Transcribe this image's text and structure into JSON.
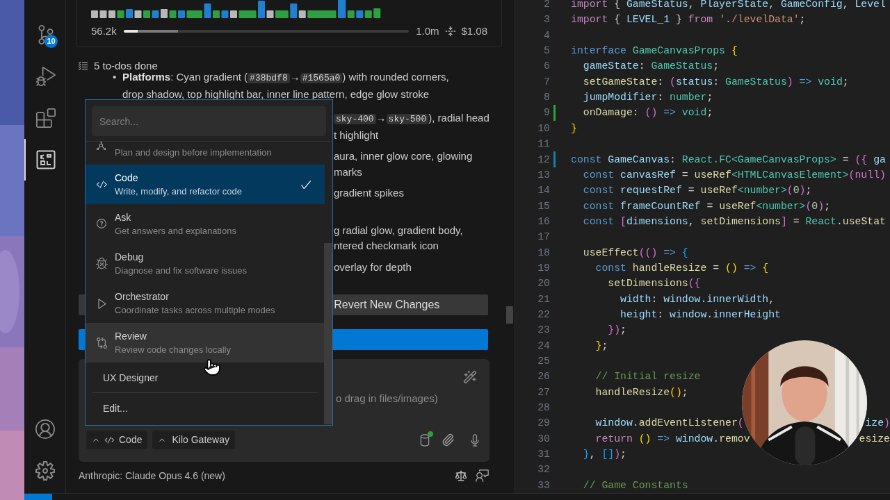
{
  "activity_bar": {
    "items": [
      {
        "selected": false,
        "badge": "10"
      },
      {
        "selected": false
      },
      {
        "selected": false
      },
      {
        "selected": true
      }
    ]
  },
  "usage": {
    "tokens": "56.2k",
    "context_window": "1.0m",
    "cost": "$1.08",
    "context_bar": {
      "used": {
        "level": 0.05
      },
      "reserved": {
        "level": 0.14
      }
    }
  },
  "todos": {
    "summary": "5 to-dos done"
  },
  "notes": [
    {
      "clipped": false,
      "marker": "•",
      "lines": [
        [
          {
            "kind": "bold",
            "text": "Platforms"
          },
          {
            "kind": "text",
            "text": ": Cyan gradient ("
          },
          {
            "kind": "code",
            "text": "#38bdf8"
          },
          {
            "kind": "text",
            "text": "→"
          },
          {
            "kind": "code",
            "text": "#1565a0"
          },
          {
            "kind": "text",
            "text": ") with rounded corners,"
          }
        ],
        [
          {
            "kind": "text",
            "text": "drop shadow, top highlight bar, inner line pattern, edge glow stroke"
          }
        ]
      ]
    },
    {
      "clipped": true,
      "lines": [
        [
          {
            "kind": "code",
            "text": "sky-400"
          },
          {
            "kind": "text",
            "text": "→"
          },
          {
            "kind": "code",
            "text": "sky-500"
          },
          {
            "kind": "text",
            "text": "), radial head"
          }
        ],
        [
          {
            "kind": "text",
            "text": "t highlight"
          }
        ]
      ]
    },
    {
      "clipped": true,
      "lines": [
        [
          {
            "kind": "text",
            "text": "aura, inner glow core, glowing"
          }
        ],
        [
          {
            "kind": "text",
            "text": "marks"
          }
        ]
      ]
    },
    {
      "clipped": true,
      "lines": [
        [
          {
            "kind": "text",
            "text": "gradient spikes"
          }
        ]
      ]
    },
    {
      "clipped": true,
      "lines": [
        [
          {
            "kind": "text",
            "text": "g radial glow, gradient body,"
          }
        ],
        [
          {
            "kind": "text",
            "text": "ntered checkmark icon"
          }
        ]
      ]
    },
    {
      "clipped": true,
      "lines": [
        [
          {
            "kind": "text",
            "text": "overlay for depth"
          }
        ]
      ]
    }
  ],
  "actions": [
    {
      "kind": "secondary"
    },
    {
      "kind": "secondary",
      "label": "Revert New Changes"
    },
    {
      "kind": "primary"
    }
  ],
  "composer": {
    "placeholder": "o drag in files/images)",
    "mode_chip": "Code",
    "provider_chip": "Kilo Gateway",
    "index_ready": true
  },
  "model": "Anthropic: Claude Opus 4.6 (new)",
  "mode_menu": {
    "search": {
      "placeholder": "Search..."
    },
    "items": [
      {
        "description": "Plan and design before implementation",
        "selected": false,
        "hovered": false
      },
      {
        "title": "Code",
        "description": "Write, modify, and refactor code",
        "selected": true,
        "hovered": false
      },
      {
        "title": "Ask",
        "description": "Get answers and explanations",
        "selected": false,
        "hovered": false
      },
      {
        "title": "Debug",
        "description": "Diagnose and fix software issues",
        "selected": false,
        "hovered": false
      },
      {
        "title": "Orchestrator",
        "description": "Coordinate tasks across multiple modes",
        "selected": false,
        "hovered": false
      },
      {
        "title": "Review",
        "description": "Review code changes locally",
        "selected": false,
        "hovered": true
      },
      {
        "title": "UX Designer",
        "selected": false,
        "hovered": false
      }
    ],
    "footer": "Edit..."
  },
  "editor": {
    "lines": [
      {
        "number": "2",
        "tokens": [
          {
            "kind": "ctl",
            "text": "import"
          },
          {
            "kind": "p",
            "text": " { "
          },
          {
            "kind": "var",
            "text": "GameStatus, PlayerState, GameConfig, Level"
          }
        ]
      },
      {
        "number": "3",
        "tokens": [
          {
            "kind": "ctl",
            "text": "import"
          },
          {
            "kind": "p",
            "text": " { "
          },
          {
            "kind": "var",
            "text": "LEVEL_1"
          },
          {
            "kind": "p",
            "text": " } "
          },
          {
            "kind": "ctl",
            "text": "from"
          },
          {
            "kind": "str",
            "text": " './levelData'"
          },
          {
            "kind": "p",
            "text": ";"
          }
        ]
      },
      {
        "number": "4"
      },
      {
        "number": "5",
        "tokens": [
          {
            "kind": "kw",
            "text": "interface"
          },
          {
            "kind": "type",
            "text": " GameCanvasProps"
          },
          {
            "kind": "br",
            "text": " {"
          }
        ]
      },
      {
        "number": "6",
        "tokens": [
          {
            "kind": "var",
            "text": "  gameState"
          },
          {
            "kind": "p",
            "text": ": "
          },
          {
            "kind": "type",
            "text": "GameStatus"
          },
          {
            "kind": "p",
            "text": ";"
          }
        ]
      },
      {
        "number": "7",
        "tokens": [
          {
            "kind": "fn",
            "text": "  setGameState"
          },
          {
            "kind": "p",
            "text": ": "
          },
          {
            "kind": "br2",
            "text": "("
          },
          {
            "kind": "var",
            "text": "status"
          },
          {
            "kind": "p",
            "text": ": "
          },
          {
            "kind": "type",
            "text": "GameStatus"
          },
          {
            "kind": "br2",
            "text": ")"
          },
          {
            "kind": "kw",
            "text": " =>"
          },
          {
            "kind": "type",
            "text": " void"
          },
          {
            "kind": "p",
            "text": ";"
          }
        ]
      },
      {
        "number": "8",
        "tokens": [
          {
            "kind": "var",
            "text": "  jumpModifier"
          },
          {
            "kind": "p",
            "text": ": "
          },
          {
            "kind": "type",
            "text": "number"
          },
          {
            "kind": "p",
            "text": ";"
          }
        ]
      },
      {
        "number": "9",
        "color": "#2ea043",
        "tokens": [
          {
            "kind": "fn",
            "text": "  onDamage"
          },
          {
            "kind": "p",
            "text": ": "
          },
          {
            "kind": "br2",
            "text": "()"
          },
          {
            "kind": "kw",
            "text": " =>"
          },
          {
            "kind": "type",
            "text": " void"
          },
          {
            "kind": "p",
            "text": ";"
          }
        ]
      },
      {
        "number": "10",
        "tokens": [
          {
            "kind": "br",
            "text": "}"
          }
        ]
      },
      {
        "number": "11"
      },
      {
        "number": "12",
        "color": "#1b7fa8",
        "tokens": [
          {
            "kind": "kw",
            "text": "const"
          },
          {
            "kind": "var",
            "text": " GameCanvas"
          },
          {
            "kind": "p",
            "text": ": "
          },
          {
            "kind": "type",
            "text": "React.FC<GameCanvasProps>"
          },
          {
            "kind": "p",
            "text": " = "
          },
          {
            "kind": "br2",
            "text": "({"
          },
          {
            "kind": "var",
            "text": " ga"
          }
        ]
      },
      {
        "number": "13",
        "tokens": [
          {
            "kind": "kw",
            "text": "  const"
          },
          {
            "kind": "var",
            "text": " canvasRef"
          },
          {
            "kind": "p",
            "text": " = "
          },
          {
            "kind": "fn",
            "text": "useRef"
          },
          {
            "kind": "type",
            "text": "<HTMLCanvasElement>"
          },
          {
            "kind": "br2",
            "text": "(null)"
          }
        ]
      },
      {
        "number": "14",
        "tokens": [
          {
            "kind": "kw",
            "text": "  const"
          },
          {
            "kind": "var",
            "text": " requestRef"
          },
          {
            "kind": "p",
            "text": " = "
          },
          {
            "kind": "fn",
            "text": "useRef"
          },
          {
            "kind": "type",
            "text": "<number>"
          },
          {
            "kind": "br2",
            "text": "("
          },
          {
            "kind": "num",
            "text": "0"
          },
          {
            "kind": "br2",
            "text": ")"
          },
          {
            "kind": "p",
            "text": ";"
          }
        ]
      },
      {
        "number": "15",
        "tokens": [
          {
            "kind": "kw",
            "text": "  const"
          },
          {
            "kind": "var",
            "text": " frameCountRef"
          },
          {
            "kind": "p",
            "text": " = "
          },
          {
            "kind": "fn",
            "text": "useRef"
          },
          {
            "kind": "type",
            "text": "<number>"
          },
          {
            "kind": "br2",
            "text": "("
          },
          {
            "kind": "num",
            "text": "0"
          },
          {
            "kind": "br2",
            "text": ")"
          },
          {
            "kind": "p",
            "text": ";"
          }
        ]
      },
      {
        "number": "16",
        "tokens": [
          {
            "kind": "kw",
            "text": "  const"
          },
          {
            "kind": "br2",
            "text": " ["
          },
          {
            "kind": "var",
            "text": "dimensions"
          },
          {
            "kind": "p",
            "text": ", "
          },
          {
            "kind": "fn",
            "text": "setDimensions"
          },
          {
            "kind": "br2",
            "text": "]"
          },
          {
            "kind": "p",
            "text": " = "
          },
          {
            "kind": "type",
            "text": "React"
          },
          {
            "kind": "p",
            "text": "."
          },
          {
            "kind": "fn",
            "text": "useStat"
          }
        ]
      },
      {
        "number": "17"
      },
      {
        "number": "18",
        "tokens": [
          {
            "kind": "fn",
            "text": "  useEffect"
          },
          {
            "kind": "br2",
            "text": "(()"
          },
          {
            "kind": "kw",
            "text": " =>"
          },
          {
            "kind": "br3",
            "text": " {"
          }
        ]
      },
      {
        "number": "19",
        "tokens": [
          {
            "kind": "kw",
            "text": "    const"
          },
          {
            "kind": "fn",
            "text": " handleResize"
          },
          {
            "kind": "p",
            "text": " = "
          },
          {
            "kind": "br",
            "text": "()"
          },
          {
            "kind": "kw",
            "text": " =>"
          },
          {
            "kind": "br",
            "text": " {"
          }
        ]
      },
      {
        "number": "20",
        "tokens": [
          {
            "kind": "fn",
            "text": "      setDimensions"
          },
          {
            "kind": "br2",
            "text": "({"
          }
        ]
      },
      {
        "number": "21",
        "tokens": [
          {
            "kind": "var",
            "text": "        width"
          },
          {
            "kind": "p",
            "text": ": "
          },
          {
            "kind": "var",
            "text": "window.innerWidth"
          },
          {
            "kind": "p",
            "text": ","
          }
        ]
      },
      {
        "number": "22",
        "tokens": [
          {
            "kind": "var",
            "text": "        height"
          },
          {
            "kind": "p",
            "text": ": "
          },
          {
            "kind": "var",
            "text": "window.innerHeight"
          }
        ]
      },
      {
        "number": "23",
        "tokens": [
          {
            "kind": "br2",
            "text": "      })"
          },
          {
            "kind": "p",
            "text": ";"
          }
        ]
      },
      {
        "number": "24",
        "tokens": [
          {
            "kind": "br",
            "text": "    }"
          },
          {
            "kind": "p",
            "text": ";"
          }
        ]
      },
      {
        "number": "25"
      },
      {
        "number": "26",
        "tokens": [
          {
            "kind": "com",
            "text": "    // Initial resize"
          }
        ]
      },
      {
        "number": "27",
        "tokens": [
          {
            "kind": "fn",
            "text": "    handleResize"
          },
          {
            "kind": "br",
            "text": "()"
          },
          {
            "kind": "p",
            "text": ";"
          }
        ]
      },
      {
        "number": "28"
      },
      {
        "number": "29",
        "tokens": [
          {
            "kind": "var",
            "text": "    window"
          },
          {
            "kind": "p",
            "text": "."
          },
          {
            "kind": "fn",
            "text": "addEventListener"
          },
          {
            "kind": "br2",
            "text": "("
          }
        ],
        "tail": [
          {
            "kind": "var",
            "text": "ize"
          },
          {
            "kind": "br2",
            "text": ")"
          }
        ]
      },
      {
        "number": "30",
        "tokens": [
          {
            "kind": "ctl",
            "text": "    return"
          },
          {
            "kind": "br",
            "text": " ()"
          },
          {
            "kind": "kw",
            "text": " =>"
          },
          {
            "kind": "var",
            "text": " window"
          },
          {
            "kind": "p",
            "text": "."
          },
          {
            "kind": "fn",
            "text": "remov"
          }
        ],
        "tail": [
          {
            "kind": "fn",
            "text": "esize"
          }
        ]
      },
      {
        "number": "31",
        "tokens": [
          {
            "kind": "br3",
            "text": "  }"
          },
          {
            "kind": "p",
            "text": ", "
          },
          {
            "kind": "br3",
            "text": "[]"
          },
          {
            "kind": "br2",
            "text": ")"
          },
          {
            "kind": "p",
            "text": ";"
          }
        ]
      },
      {
        "number": "32"
      },
      {
        "number": "33",
        "tokens": [
          {
            "kind": "com",
            "text": "  // Game Constants"
          }
        ]
      }
    ]
  }
}
